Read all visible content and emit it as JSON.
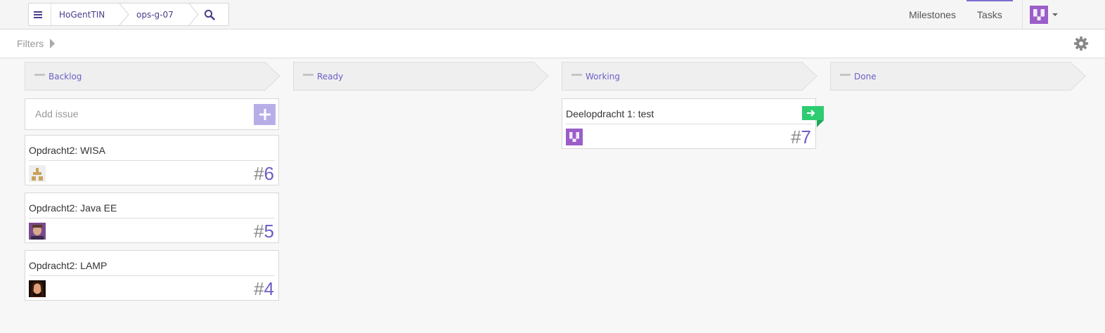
{
  "breadcrumb": {
    "org": "HoGentTIN",
    "repo": "ops-g-07"
  },
  "nav": {
    "milestones": "Milestones",
    "tasks": "Tasks"
  },
  "filters": {
    "label": "Filters"
  },
  "columns": [
    {
      "title": "Backlog"
    },
    {
      "title": "Ready"
    },
    {
      "title": "Working"
    },
    {
      "title": "Done"
    }
  ],
  "add_issue": {
    "placeholder": "Add issue"
  },
  "backlog_cards": [
    {
      "title": "Opdracht2: WISA",
      "number": "6"
    },
    {
      "title": "Opdracht2: Java EE",
      "number": "5"
    },
    {
      "title": "Opdracht2: LAMP",
      "number": "4"
    }
  ],
  "working_cards": [
    {
      "title": "Deelopdracht 1: test",
      "number": "7"
    }
  ],
  "colors": {
    "accent": "#6b5fc7",
    "add_button": "#b7aee8",
    "flag": "#2ecc71"
  }
}
